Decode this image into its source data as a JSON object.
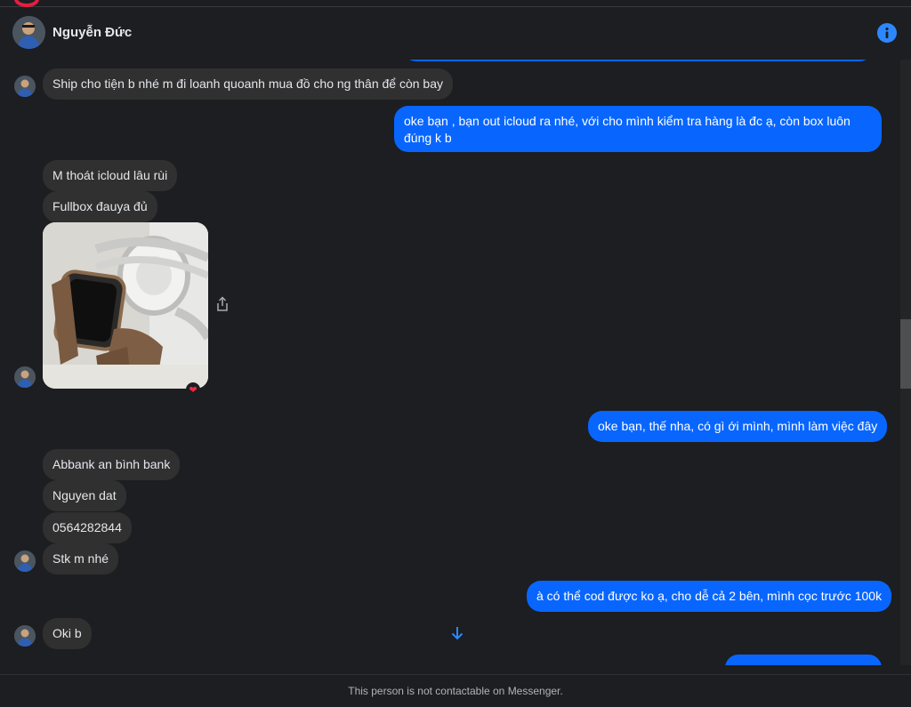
{
  "header": {
    "name": "Nguyễn Đức"
  },
  "messages": [
    {
      "dir": "in",
      "text": "Ship cho tiện b nhé m đi loanh quoanh mua đồ cho ng thân để còn bay"
    },
    {
      "dir": "out",
      "line1": "oke bạn , bạn out icloud ra nhé, với cho mình kiểm tra hàng là đc ạ, còn box luôn",
      "line2": "đúng k b"
    },
    {
      "dir": "in",
      "text": "M thoát icloud lâu rùi"
    },
    {
      "dir": "in",
      "text": "Fullbox đauya đủ"
    },
    {
      "dir": "out",
      "text": "oke bạn, thế nha, có gì ới mình, mình làm việc đây"
    },
    {
      "dir": "in",
      "text": "Abbank an bình bank"
    },
    {
      "dir": "in",
      "text": "Nguyen dat"
    },
    {
      "dir": "in",
      "text": "0564282844"
    },
    {
      "dir": "in",
      "text": "Stk m nhé"
    },
    {
      "dir": "out",
      "text": "à có thể cod được ko ạ, cho dễ cả 2 bên, mình cọc trước 100k"
    },
    {
      "dir": "in",
      "text": "Oki b"
    }
  ],
  "photo": {
    "reaction": "❤"
  },
  "icons": {
    "info": "info-icon",
    "share": "share-icon",
    "scroll": "arrow-down-icon"
  },
  "colors": {
    "outgoing": "#0866ff",
    "incoming": "#303030",
    "accent": "#2d88ff"
  },
  "footer": {
    "text": "This person is not contactable on Messenger."
  }
}
